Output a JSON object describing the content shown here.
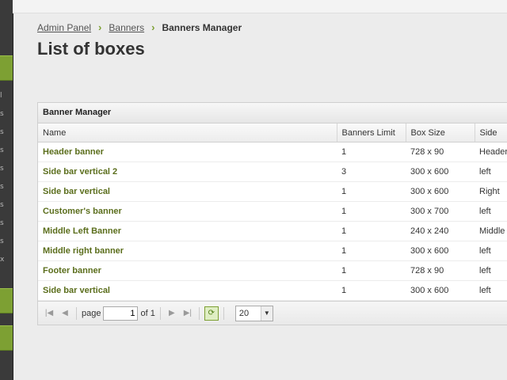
{
  "breadcrumb": {
    "items": [
      "Admin Panel",
      "Banners"
    ],
    "current": "Banners Manager"
  },
  "page": {
    "title": "List of boxes"
  },
  "panel": {
    "title": "Banner Manager",
    "columns": [
      "Name",
      "Banners Limit",
      "Box Size",
      "Side"
    ],
    "rows": [
      {
        "name": "Header banner",
        "limit": "1",
        "size": "728 x 90",
        "side": "Header"
      },
      {
        "name": "Side bar vertical 2",
        "limit": "3",
        "size": "300 x 600",
        "side": "left"
      },
      {
        "name": "Side bar vertical",
        "limit": "1",
        "size": "300 x 600",
        "side": "Right"
      },
      {
        "name": "Customer's banner",
        "limit": "1",
        "size": "300 x 700",
        "side": "left"
      },
      {
        "name": "Middle Left Banner",
        "limit": "1",
        "size": "240 x 240",
        "side": "Middle l"
      },
      {
        "name": "Middle right banner",
        "limit": "1",
        "size": "300 x 600",
        "side": "left"
      },
      {
        "name": "Footer banner",
        "limit": "1",
        "size": "728 x 90",
        "side": "left"
      },
      {
        "name": "Side bar vertical",
        "limit": "1",
        "size": "300 x 600",
        "side": "left"
      }
    ]
  },
  "pager": {
    "page_label": "page",
    "page_value": "1",
    "of_label": "of 1",
    "page_size": "20"
  },
  "colors": {
    "accent": "#7da033",
    "link": "#5b6e1c"
  }
}
